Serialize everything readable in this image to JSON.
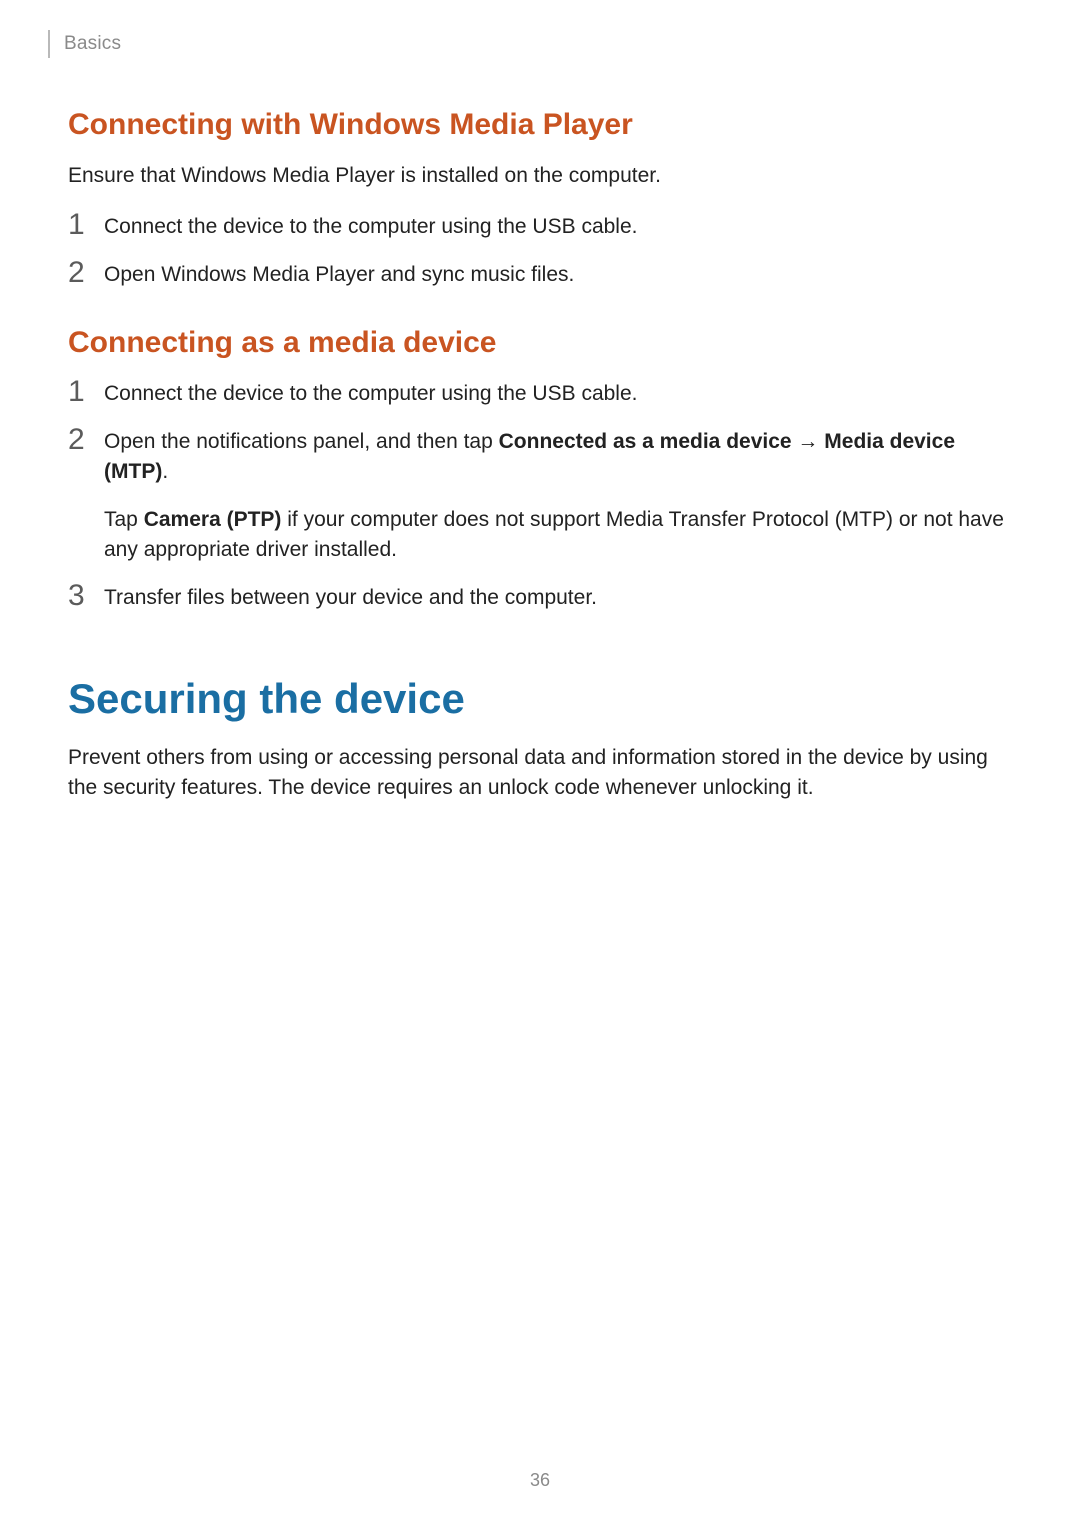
{
  "header": {
    "breadcrumb": "Basics"
  },
  "section1": {
    "heading": "Connecting with Windows Media Player",
    "intro": "Ensure that Windows Media Player is installed on the computer.",
    "steps": [
      {
        "num": "1",
        "text": "Connect the device to the computer using the USB cable."
      },
      {
        "num": "2",
        "text": "Open Windows Media Player and sync music files."
      }
    ]
  },
  "section2": {
    "heading": "Connecting as a media device",
    "steps": [
      {
        "num": "1",
        "text": "Connect the device to the computer using the USB cable."
      },
      {
        "num": "2",
        "html_parts": {
          "prefix": "Open the notifications panel, and then tap ",
          "bold1": "Connected as a media device",
          "arrow": " → ",
          "bold2": "Media device (MTP)",
          "suffix": "."
        },
        "secondary": {
          "prefix": "Tap ",
          "bold": "Camera (PTP)",
          "suffix": " if your computer does not support Media Transfer Protocol (MTP) or not have any appropriate driver installed."
        }
      },
      {
        "num": "3",
        "text": "Transfer files between your device and the computer."
      }
    ]
  },
  "section3": {
    "heading": "Securing the device",
    "body": "Prevent others from using or accessing personal data and information stored in the device by using the security features. The device requires an unlock code whenever unlocking it."
  },
  "page_number": "36"
}
